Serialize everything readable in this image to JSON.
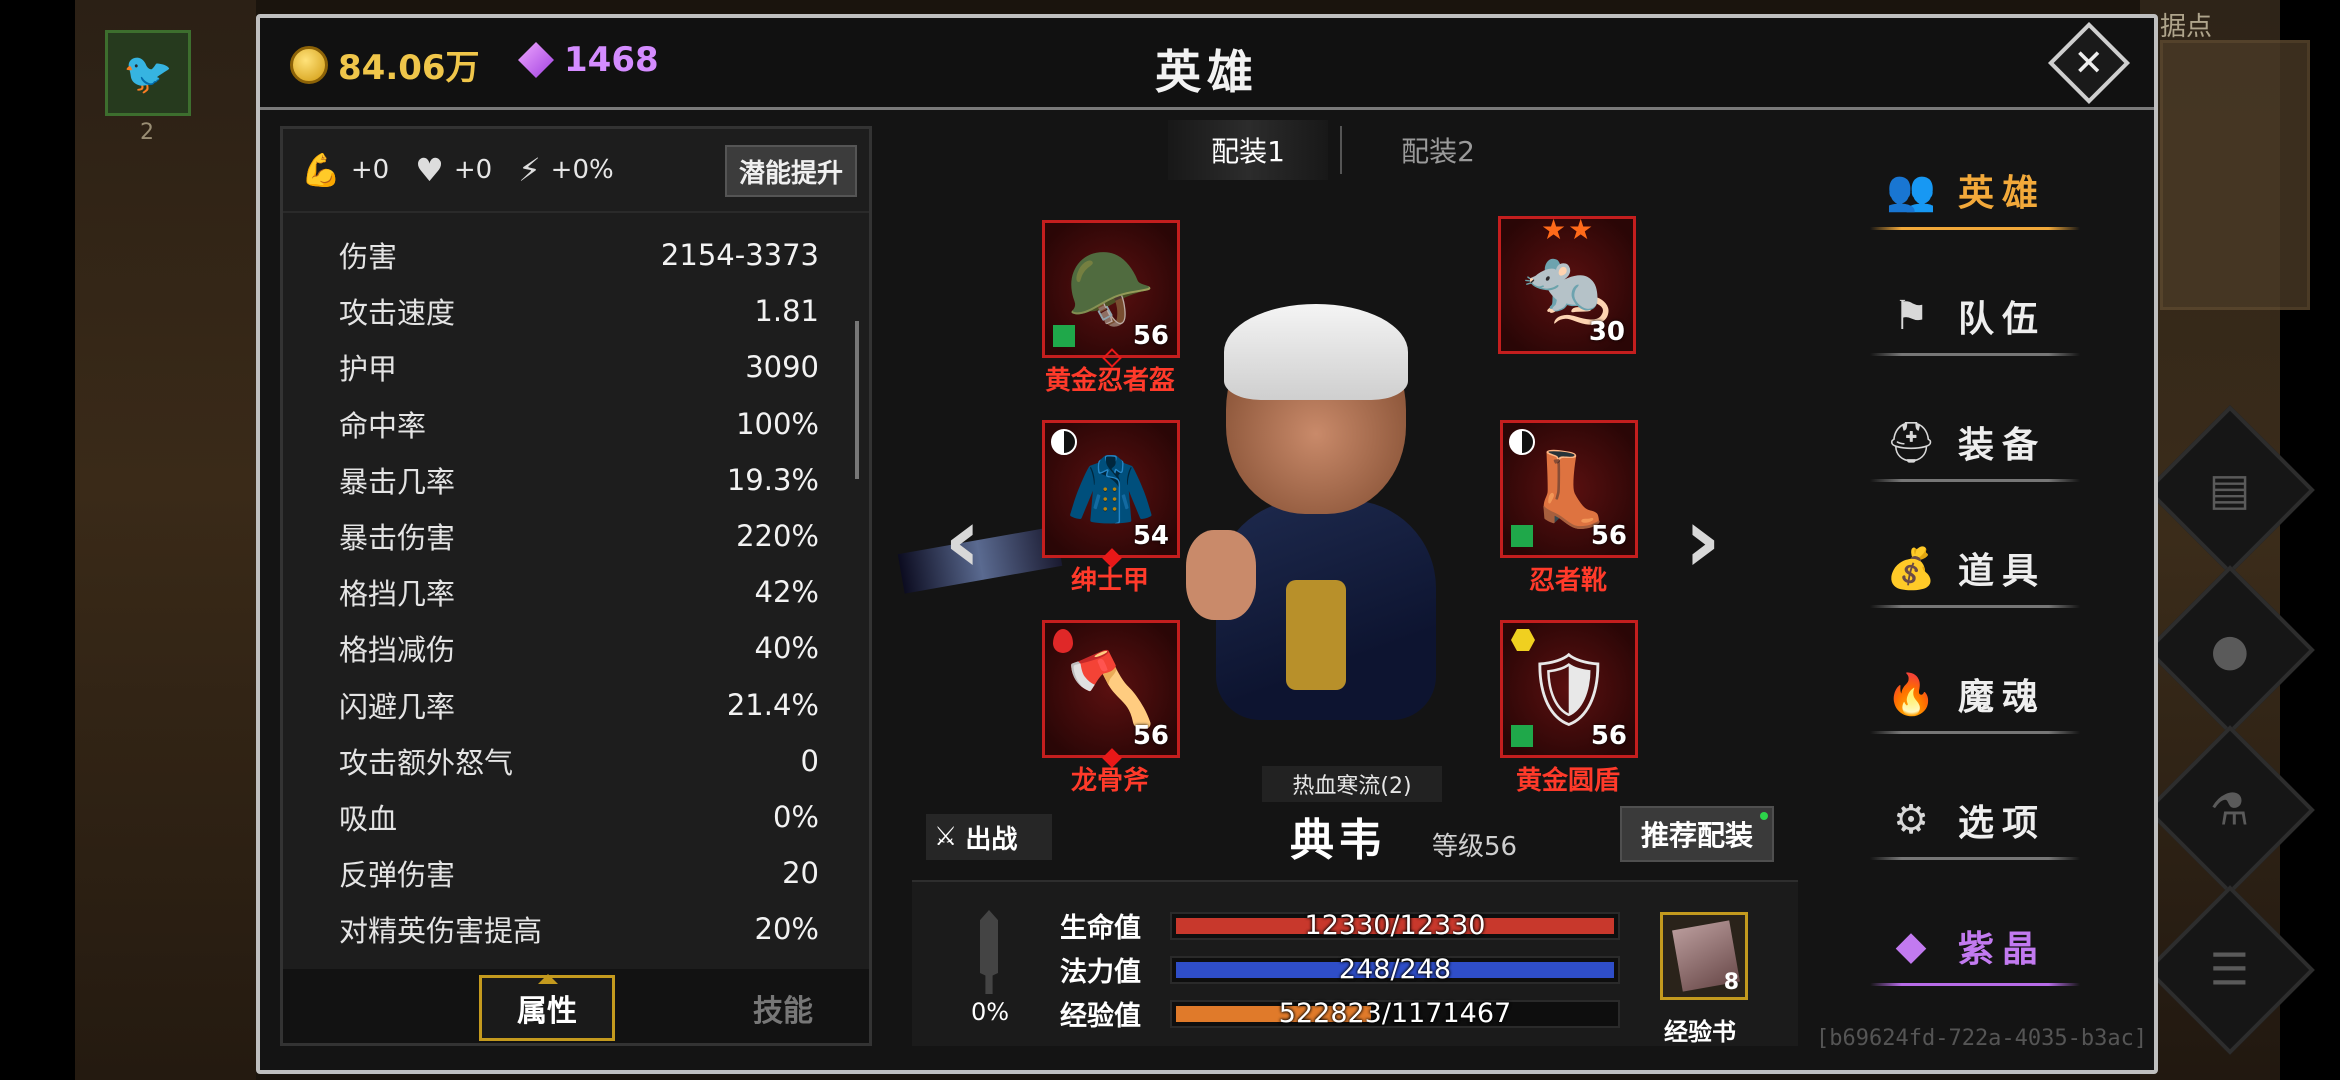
{
  "currency": {
    "gold": "84.06万",
    "gems": "1468"
  },
  "window_title": "英雄",
  "background": {
    "map_label": "据点",
    "bird_count": "2"
  },
  "stats_panel": {
    "bonuses": [
      {
        "icon": "strength-arm-icon",
        "value": "+0"
      },
      {
        "icon": "heart-icon",
        "value": "+0"
      },
      {
        "icon": "lightning-icon",
        "value": "+0%"
      }
    ],
    "potential_button": "潜能提升",
    "rows": [
      {
        "label": "伤害",
        "value": "2154-3373"
      },
      {
        "label": "攻击速度",
        "value": "1.81"
      },
      {
        "label": "护甲",
        "value": "3090"
      },
      {
        "label": "命中率",
        "value": "100%"
      },
      {
        "label": "暴击几率",
        "value": "19.3%"
      },
      {
        "label": "暴击伤害",
        "value": "220%"
      },
      {
        "label": "格挡几率",
        "value": "42%"
      },
      {
        "label": "格挡减伤",
        "value": "40%"
      },
      {
        "label": "闪避几率",
        "value": "21.4%"
      },
      {
        "label": "攻击额外怒气",
        "value": "0"
      },
      {
        "label": "吸血",
        "value": "0%"
      },
      {
        "label": "反弹伤害",
        "value": "20"
      },
      {
        "label": "对精英伤害提高",
        "value": "20%"
      }
    ],
    "tabs": {
      "attributes": "属性",
      "skills": "技能"
    }
  },
  "loadout_tabs": [
    "配装1",
    "配装2"
  ],
  "equipment": {
    "helmet": {
      "name": "黄金忍者盔",
      "level": "56",
      "art": "golden-helmet"
    },
    "pet": {
      "name": "",
      "level": "30",
      "stars": "★★",
      "art": "white-rat-pet"
    },
    "armor": {
      "name": "绅士甲",
      "level": "54",
      "art": "green-coat"
    },
    "boots": {
      "name": "忍者靴",
      "level": "56",
      "art": "green-boots"
    },
    "weapon": {
      "name": "龙骨斧",
      "level": "56",
      "art": "bone-axe"
    },
    "shield": {
      "name": "黄金圆盾",
      "level": "56",
      "art": "gold-shield"
    }
  },
  "hero": {
    "set_bonus": "热血寒流(2)",
    "name": "典韦",
    "level": "等级56",
    "sortie_label": "出战",
    "recommend_label": "推荐配装",
    "rage_pct": "0%",
    "bars": [
      {
        "label": "生命值",
        "text": "12330/12330",
        "fill": 1.0,
        "color": "#c8382c"
      },
      {
        "label": "法力值",
        "text": "248/248",
        "fill": 1.0,
        "color": "#2f4ec8"
      },
      {
        "label": "经验值",
        "text": "522823/1171467",
        "fill": 0.446,
        "color": "#e07a2a"
      }
    ],
    "exp_book": {
      "label": "经验书",
      "count": "8"
    }
  },
  "menu": [
    {
      "key": "hero",
      "label": "英雄",
      "icon": "people-icon",
      "glyph": "👥",
      "state": "active"
    },
    {
      "key": "team",
      "label": "队伍",
      "icon": "flag-icon",
      "glyph": "⚑",
      "state": ""
    },
    {
      "key": "equipment",
      "label": "装备",
      "icon": "helmet-icon",
      "glyph": "⛑",
      "state": ""
    },
    {
      "key": "items",
      "label": "道具",
      "icon": "bag-icon",
      "glyph": "💰",
      "state": ""
    },
    {
      "key": "soul",
      "label": "魔魂",
      "icon": "flame-icon",
      "glyph": "🔥",
      "state": ""
    },
    {
      "key": "options",
      "label": "选项",
      "icon": "gear-icon",
      "glyph": "⚙",
      "state": ""
    },
    {
      "key": "crystal",
      "label": "紫晶",
      "icon": "purple-crystal-icon",
      "glyph": "◆",
      "state": "purple"
    }
  ],
  "session_id": "[b69624fd-722a-4035-b3ac]"
}
